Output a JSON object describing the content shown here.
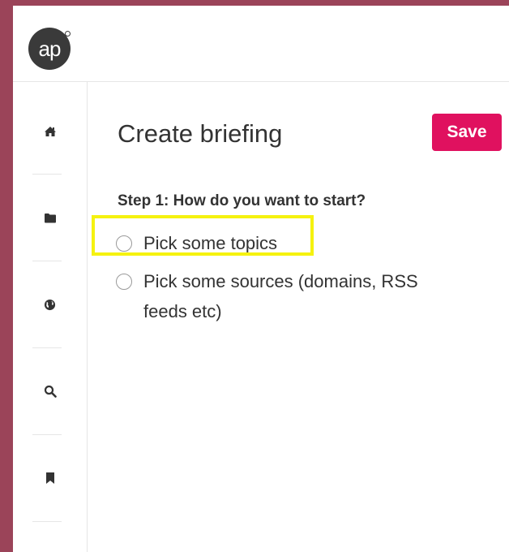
{
  "logo": {
    "text": "ap"
  },
  "sidebar": {
    "items": [
      {
        "name": "home",
        "icon": "home-icon"
      },
      {
        "name": "folder",
        "icon": "folder-icon"
      },
      {
        "name": "globe",
        "icon": "globe-icon"
      },
      {
        "name": "search",
        "icon": "search-icon"
      },
      {
        "name": "bookmark",
        "icon": "bookmark-icon"
      }
    ]
  },
  "main": {
    "title": "Create briefing",
    "save_label": "Save",
    "step_label": "Step 1: How do you want to start?",
    "options": [
      {
        "label": "Pick some topics",
        "selected": false,
        "highlighted": true
      },
      {
        "label": "Pick some sources (domains, RSS feeds etc)",
        "selected": false,
        "highlighted": false
      }
    ]
  },
  "colors": {
    "frame_bg": "#9b4459",
    "accent": "#e0115f",
    "highlight": "#f5f20f",
    "text": "#333333"
  }
}
